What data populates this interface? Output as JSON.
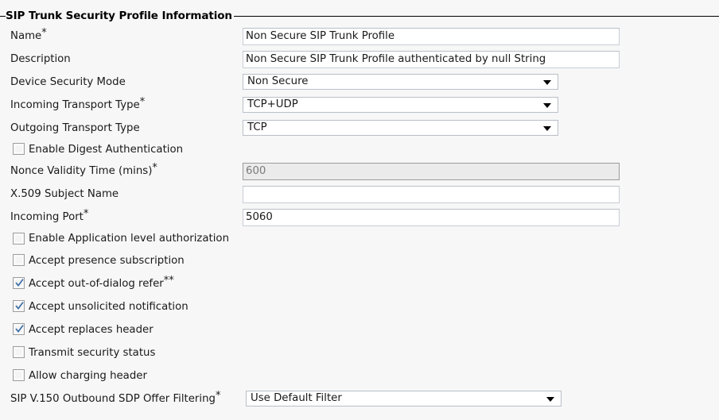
{
  "panel": {
    "legend": "SIP Trunk Security Profile Information"
  },
  "fields": {
    "name": {
      "label": "Name",
      "required": true,
      "value": "Non Secure SIP Trunk Profile",
      "type": "text"
    },
    "description": {
      "label": "Description",
      "required": false,
      "value": "Non Secure SIP Trunk Profile authenticated by null String",
      "type": "text"
    },
    "device_security_mode": {
      "label": "Device Security Mode",
      "required": false,
      "value": "Non Secure",
      "type": "select"
    },
    "incoming_transport_type": {
      "label": "Incoming Transport Type",
      "required": true,
      "value": "TCP+UDP",
      "type": "select"
    },
    "outgoing_transport_type": {
      "label": "Outgoing Transport Type",
      "required": false,
      "value": "TCP",
      "type": "select"
    },
    "enable_digest_authentication": {
      "label": "Enable Digest Authentication",
      "checked": false,
      "type": "checkbox"
    },
    "nonce_validity_time": {
      "label": "Nonce Validity Time (mins)",
      "required": true,
      "value": "600",
      "type": "text",
      "disabled": true
    },
    "x509_subject_name": {
      "label": "X.509 Subject Name",
      "required": false,
      "value": "",
      "type": "text"
    },
    "incoming_port": {
      "label": "Incoming Port",
      "required": true,
      "value": "5060",
      "type": "text"
    },
    "enable_application_level_authorization": {
      "label": "Enable Application level authorization",
      "checked": false,
      "type": "checkbox"
    },
    "accept_presence_subscription": {
      "label": "Accept presence subscription",
      "checked": false,
      "type": "checkbox"
    },
    "accept_out_of_dialog_refer": {
      "label": "Accept out-of-dialog refer",
      "marker": "**",
      "checked": true,
      "type": "checkbox"
    },
    "accept_unsolicited_notification": {
      "label": "Accept unsolicited notification",
      "checked": true,
      "type": "checkbox"
    },
    "accept_replaces_header": {
      "label": "Accept replaces header",
      "checked": true,
      "type": "checkbox"
    },
    "transmit_security_status": {
      "label": "Transmit security status",
      "checked": false,
      "type": "checkbox"
    },
    "allow_charging_header": {
      "label": "Allow charging header",
      "checked": false,
      "type": "checkbox"
    },
    "sip_v150_outbound_sdp_offer_filtering": {
      "label": "SIP V.150 Outbound SDP Offer Filtering",
      "required": true,
      "value": "Use Default Filter",
      "type": "select"
    }
  },
  "markers": {
    "required_star": "*",
    "double_star": "**"
  },
  "colors": {
    "page_background": "#f7f7f7",
    "input_border": "#c8cdd4",
    "disabled_background": "#ebebeb",
    "disabled_text": "#7b7b7b",
    "check_blue": "#3a6ea5",
    "text": "#1a1a1a"
  }
}
